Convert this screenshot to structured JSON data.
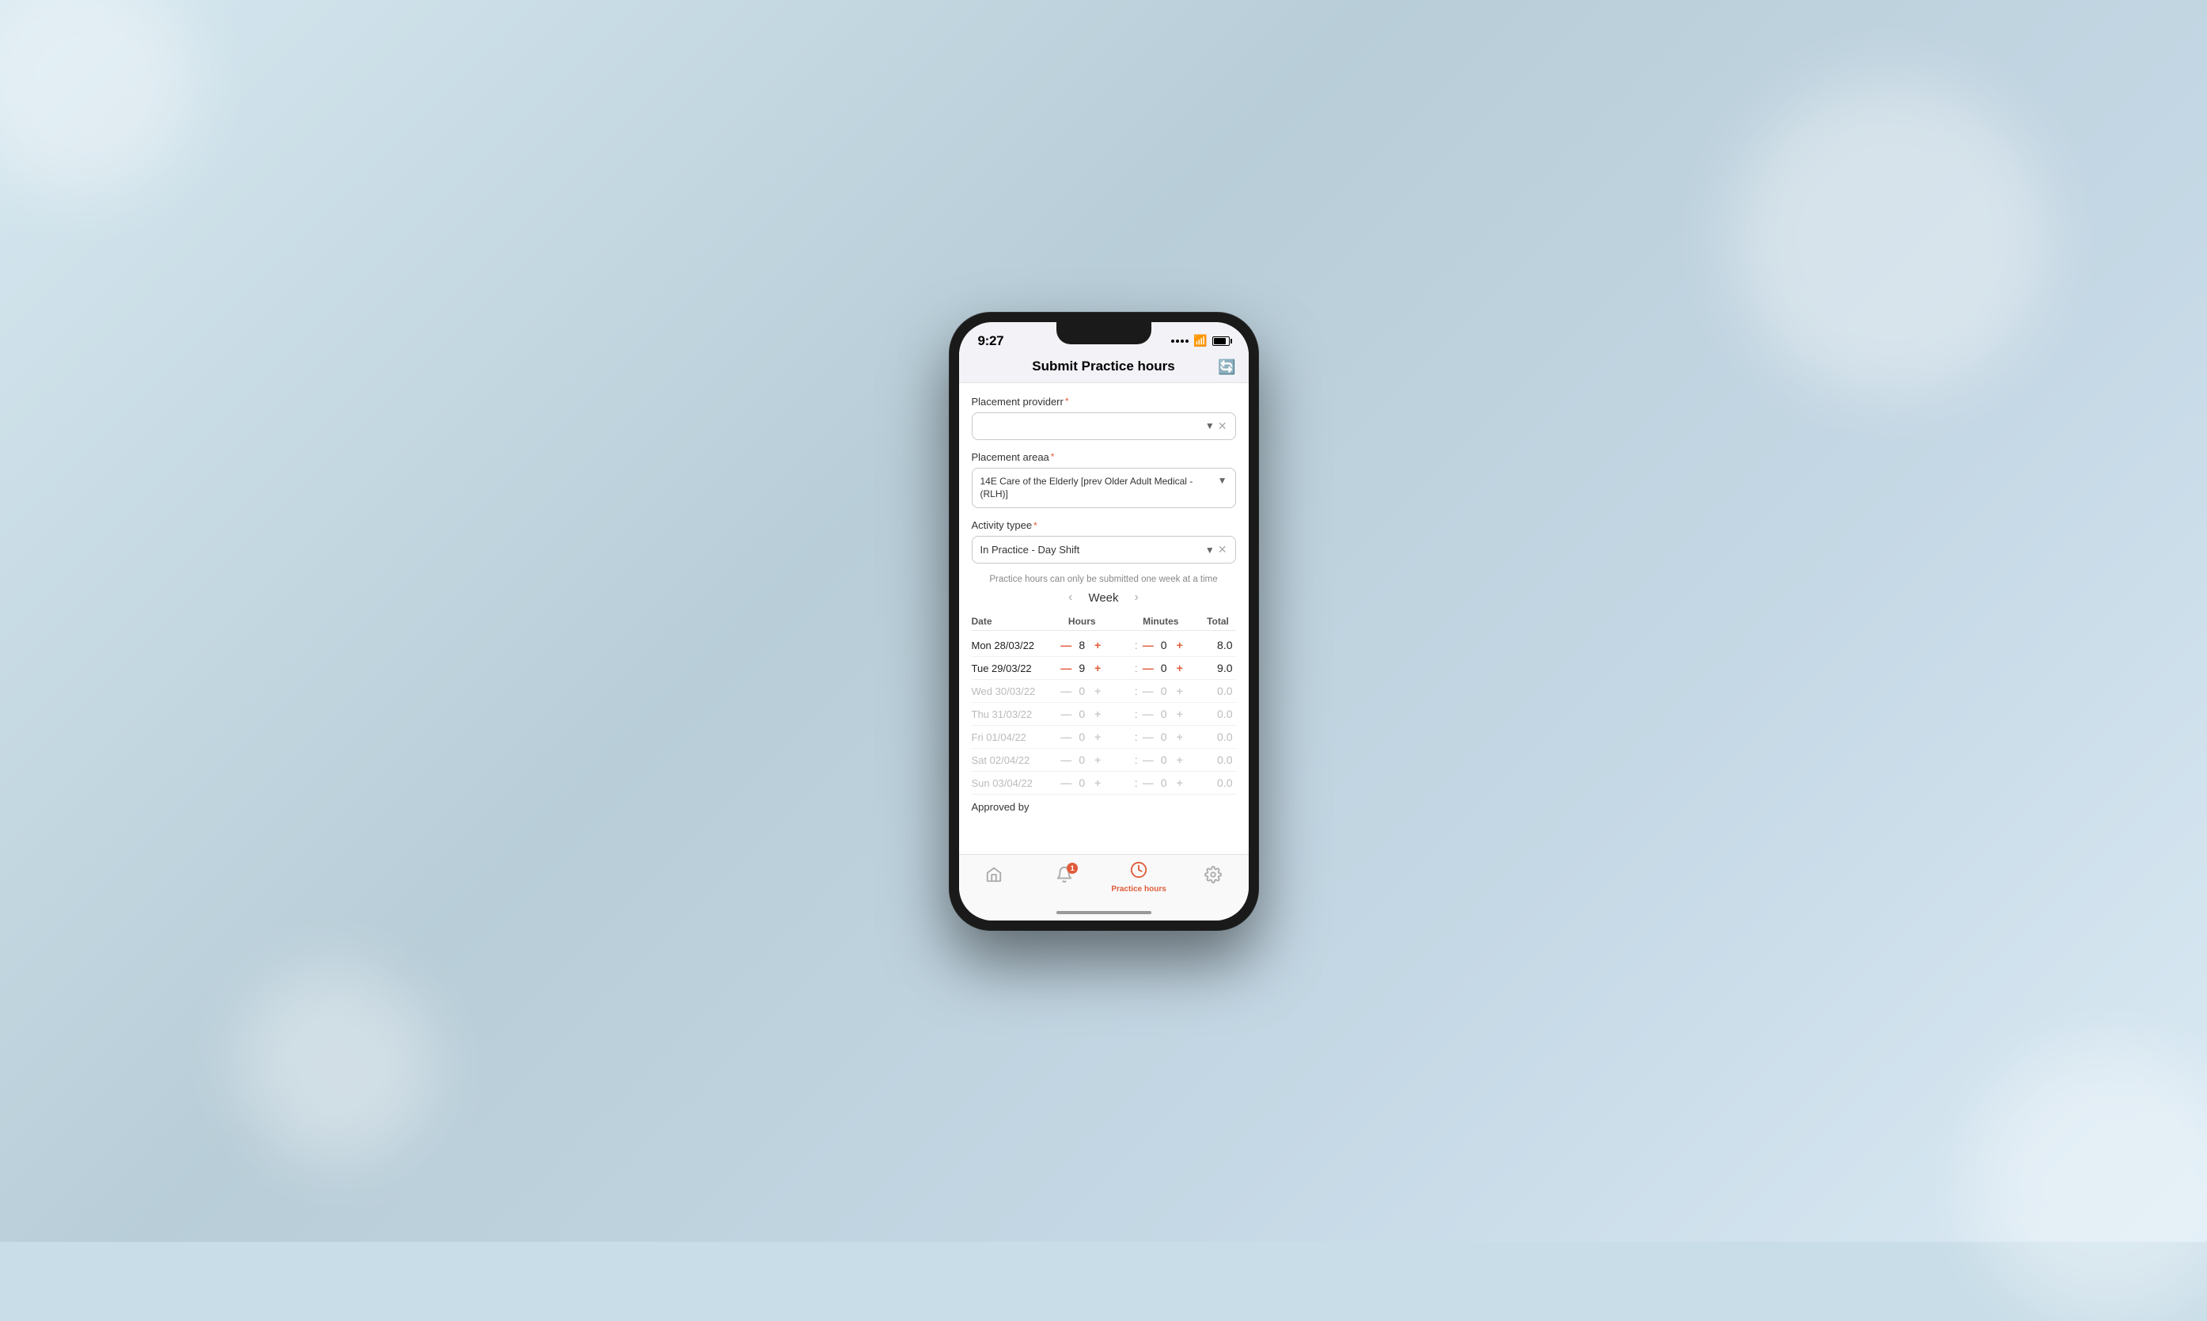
{
  "background": {
    "description": "blurred hospital corridor background"
  },
  "status_bar": {
    "time": "9:27",
    "wifi": "wifi",
    "battery": "battery"
  },
  "header": {
    "title": "Submit Practice hours",
    "history_icon": "history"
  },
  "form": {
    "placement_provider": {
      "label": "Placement providerr",
      "required": true,
      "value": "",
      "placeholder": ""
    },
    "placement_area": {
      "label": "Placement areaa",
      "required": true,
      "value": "14E Care of the Elderly [prev Older Adult Medical - (RLH)]"
    },
    "activity_type": {
      "label": "Activity typee",
      "required": true,
      "value": "In Practice - Day Shift"
    }
  },
  "week_note": "Practice hours can only be submitted one week at a time",
  "week_nav": {
    "label": "Week",
    "prev_icon": "<",
    "next_icon": ">"
  },
  "table": {
    "headers": [
      "Date",
      "Hours",
      "Minutes",
      "Total"
    ],
    "rows": [
      {
        "day": "Mon",
        "date": "28/03/22",
        "hours": "8",
        "minutes": "0",
        "total": "8.0",
        "active": true
      },
      {
        "day": "Tue",
        "date": "29/03/22",
        "hours": "9",
        "minutes": "0",
        "total": "9.0",
        "active": true
      },
      {
        "day": "Wed",
        "date": "30/03/22",
        "hours": "0",
        "minutes": "0",
        "total": "0.0",
        "active": false
      },
      {
        "day": "Thu",
        "date": "31/03/22",
        "hours": "0",
        "minutes": "0",
        "total": "0.0",
        "active": false
      },
      {
        "day": "Fri",
        "date": "01/04/22",
        "hours": "0",
        "minutes": "0",
        "total": "0.0",
        "active": false
      },
      {
        "day": "Sat",
        "date": "02/04/22",
        "hours": "0",
        "minutes": "0",
        "total": "0.0",
        "active": false
      },
      {
        "day": "Sun",
        "date": "03/04/22",
        "hours": "0",
        "minutes": "0",
        "total": "0.0",
        "active": false
      }
    ]
  },
  "approved_by_label": "Approved by",
  "bottom_nav": {
    "items": [
      {
        "id": "home",
        "icon": "🏠",
        "label": "",
        "active": false,
        "badge": null
      },
      {
        "id": "notifications",
        "icon": "🔔",
        "label": "",
        "active": false,
        "badge": "1"
      },
      {
        "id": "practice-hours",
        "icon": "🕐",
        "label": "Practice hours",
        "active": true,
        "badge": null
      },
      {
        "id": "settings",
        "icon": "⚙",
        "label": "",
        "active": false,
        "badge": null
      }
    ]
  },
  "colors": {
    "accent": "#e05c3a",
    "inactive_text": "#bbb",
    "active_text": "#222"
  }
}
